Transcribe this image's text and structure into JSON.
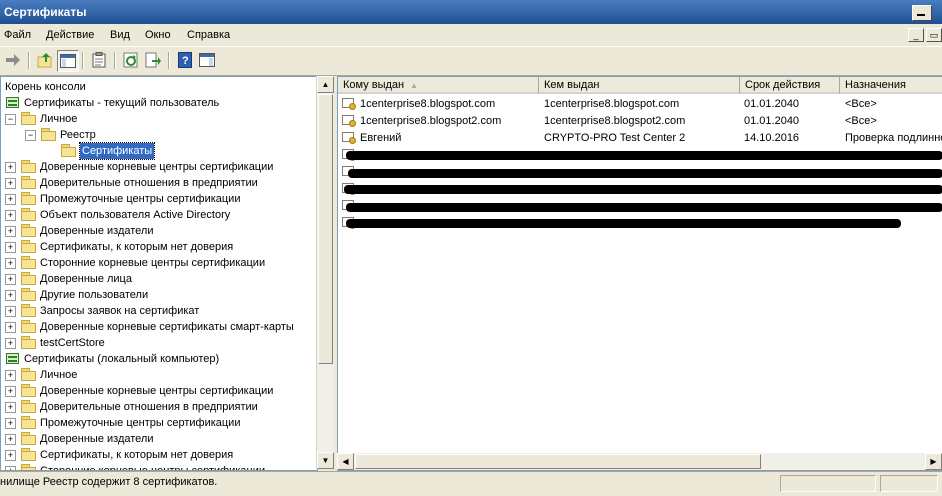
{
  "window": {
    "title": "Сертификаты"
  },
  "menu": [
    "Файл",
    "Действие",
    "Вид",
    "Окно",
    "Справка"
  ],
  "toolbar_icons": [
    "forward-arrow-icon",
    "up-folder-icon",
    "show-hide-tree-icon",
    "clipboard-icon",
    "refresh-icon",
    "export-list-icon",
    "help-icon",
    "console-pane-icon"
  ],
  "tree": {
    "root": "Корень консоли",
    "items": [
      {
        "label": "Сертификаты - текущий пользователь",
        "level": 0,
        "icon": "store",
        "expander": ""
      },
      {
        "label": "Личное",
        "level": 1,
        "icon": "folder",
        "expander": "−"
      },
      {
        "label": "Реестр",
        "level": 2,
        "icon": "folder",
        "expander": "−"
      },
      {
        "label": "Сертификаты",
        "level": 3,
        "icon": "folder-open",
        "expander": "",
        "selected": true
      },
      {
        "label": "Доверенные корневые центры сертификации",
        "level": 1,
        "icon": "folder",
        "expander": "+"
      },
      {
        "label": "Доверительные отношения в предприятии",
        "level": 1,
        "icon": "folder",
        "expander": "+"
      },
      {
        "label": "Промежуточные центры сертификации",
        "level": 1,
        "icon": "folder",
        "expander": "+"
      },
      {
        "label": "Объект пользователя Active Directory",
        "level": 1,
        "icon": "folder",
        "expander": "+"
      },
      {
        "label": "Доверенные издатели",
        "level": 1,
        "icon": "folder",
        "expander": "+"
      },
      {
        "label": "Сертификаты, к которым нет доверия",
        "level": 1,
        "icon": "folder",
        "expander": "+"
      },
      {
        "label": "Сторонние корневые центры сертификации",
        "level": 1,
        "icon": "folder",
        "expander": "+"
      },
      {
        "label": "Доверенные лица",
        "level": 1,
        "icon": "folder",
        "expander": "+"
      },
      {
        "label": "Другие пользователи",
        "level": 1,
        "icon": "folder",
        "expander": "+"
      },
      {
        "label": "Запросы заявок на сертификат",
        "level": 1,
        "icon": "folder",
        "expander": "+"
      },
      {
        "label": "Доверенные корневые сертификаты смарт-карты",
        "level": 1,
        "icon": "folder",
        "expander": "+"
      },
      {
        "label": "testCertStore",
        "level": 1,
        "icon": "folder",
        "expander": "+"
      },
      {
        "label": "Сертификаты (локальный компьютер)",
        "level": 0,
        "icon": "store",
        "expander": ""
      },
      {
        "label": "Личное",
        "level": 1,
        "icon": "folder",
        "expander": "+"
      },
      {
        "label": "Доверенные корневые центры сертификации",
        "level": 1,
        "icon": "folder",
        "expander": "+"
      },
      {
        "label": "Доверительные отношения в предприятии",
        "level": 1,
        "icon": "folder",
        "expander": "+"
      },
      {
        "label": "Промежуточные центры сертификации",
        "level": 1,
        "icon": "folder",
        "expander": "+"
      },
      {
        "label": "Доверенные издатели",
        "level": 1,
        "icon": "folder",
        "expander": "+"
      },
      {
        "label": "Сертификаты, к которым нет доверия",
        "level": 1,
        "icon": "folder",
        "expander": "+"
      },
      {
        "label": "Сторонние корневые центры сертификации",
        "level": 1,
        "icon": "folder",
        "expander": "+"
      }
    ]
  },
  "list": {
    "columns": [
      "Кому выдан",
      "Кем выдан",
      "Срок действия",
      "Назначения"
    ],
    "rows": [
      [
        "1centerprise8.blogspot.com",
        "1centerprise8.blogspot.com",
        "01.01.2040",
        "<Все>"
      ],
      [
        "1centerprise8.blogspot2.com",
        "1centerprise8.blogspot2.com",
        "01.01.2040",
        "<Все>"
      ],
      [
        "Евгений",
        "CRYPTO-PRO Test Center 2",
        "14.10.2016",
        "Проверка подлинно"
      ]
    ],
    "redacted_rows": 5
  },
  "status": {
    "text": "нилище Реестр содержит 8 сертификатов."
  }
}
